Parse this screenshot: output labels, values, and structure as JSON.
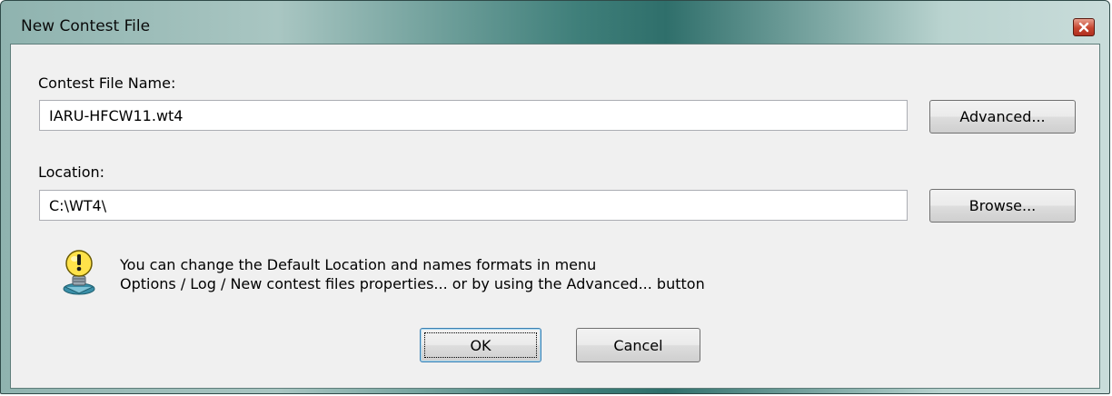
{
  "window": {
    "title": "New Contest File"
  },
  "icons": {
    "close": "close-icon",
    "info": "lightbulb-info-icon"
  },
  "fields": {
    "file_name_label": "Contest File Name:",
    "file_name_value": "IARU-HFCW11.wt4",
    "location_label": "Location:",
    "location_value": "C:\\WT4\\"
  },
  "buttons": {
    "advanced": "Advanced...",
    "browse": "Browse...",
    "ok": "OK",
    "cancel": "Cancel"
  },
  "info": {
    "line1": "You can change the Default Location and names formats in menu",
    "line2": "Options / Log / New contest files properties... or by using the Advanced... button"
  },
  "colors": {
    "close_button": "#c6452f",
    "title_bar_dark": "#2f6f6b",
    "dialog_background": "#f0f0f0"
  }
}
